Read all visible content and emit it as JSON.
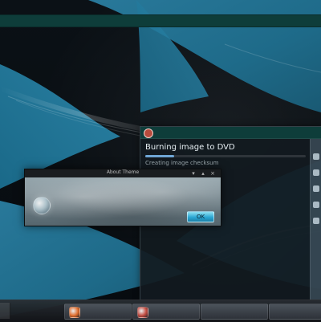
{
  "taskbar": {
    "tasks": [
      {
        "label": "",
        "icon": "firefox-icon",
        "accent": "#e06b2a"
      },
      {
        "label": "",
        "icon": "document-icon",
        "accent": "#dcdcdc"
      },
      {
        "label": "",
        "icon": "brasero-icon",
        "accent": "#c24a3f"
      },
      {
        "label": "",
        "icon": "app-icon",
        "accent": "#d45a4a"
      }
    ]
  },
  "burn_window": {
    "title": "",
    "heading": "Burning image to DVD",
    "status": "Creating image checksum",
    "progress": 0.18
  },
  "about_dialog": {
    "title": "About Theme",
    "text": "",
    "ok_label": "OK"
  }
}
